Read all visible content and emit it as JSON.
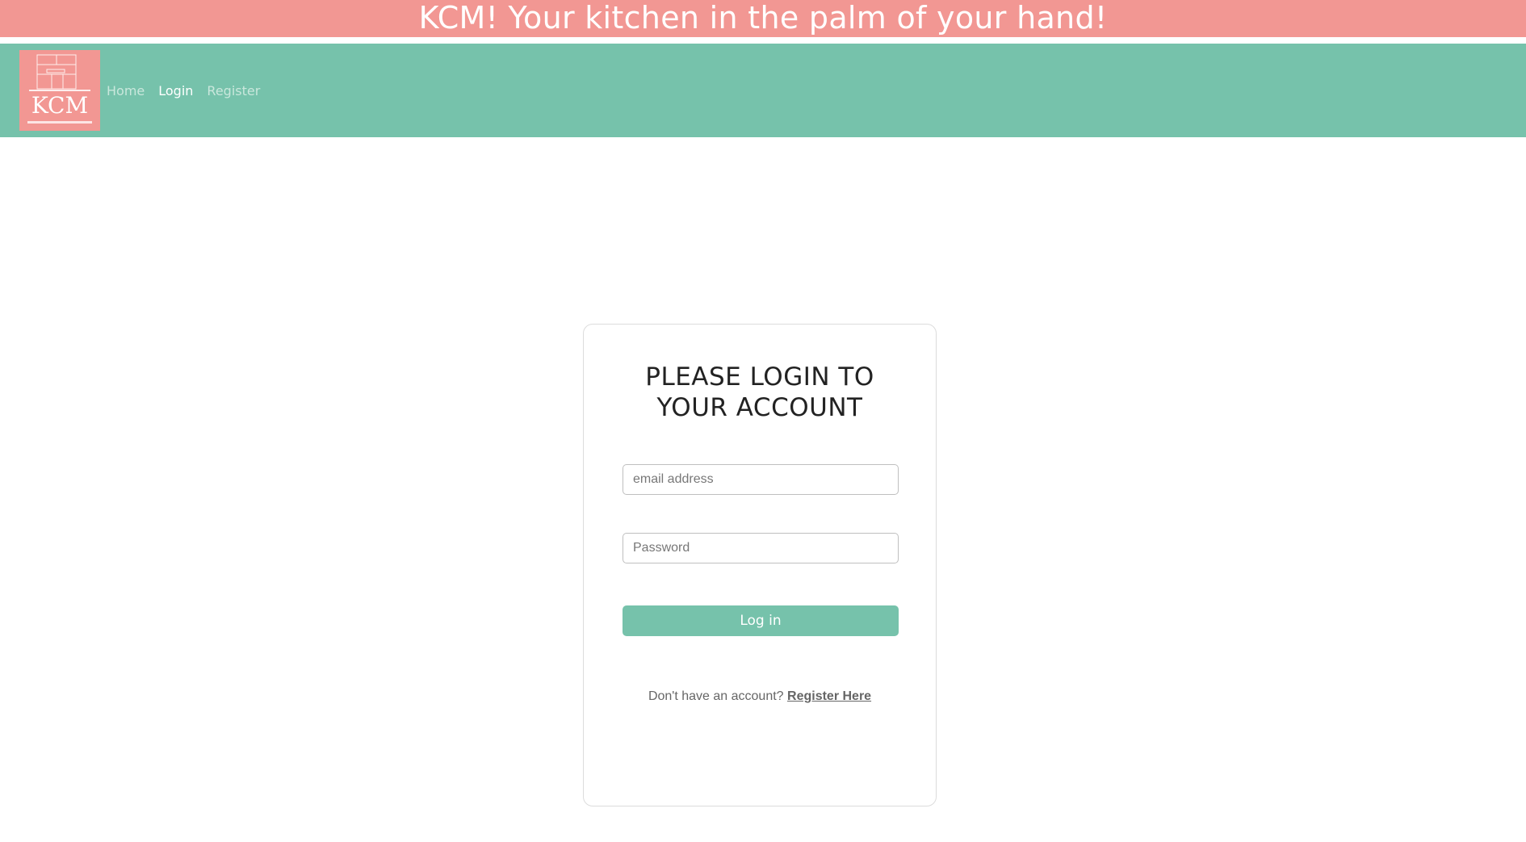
{
  "banner": {
    "text": "KCM! Your kitchen in the palm of your hand!"
  },
  "nav": {
    "logo_text": "KCM",
    "links": [
      {
        "label": "Home",
        "active": false
      },
      {
        "label": "Login",
        "active": true
      },
      {
        "label": "Register",
        "active": false
      }
    ]
  },
  "login": {
    "title_line1": "PLEASE LOGIN TO",
    "title_line2": "YOUR ACCOUNT",
    "email_placeholder": "email address",
    "email_value": "",
    "password_placeholder": "Password",
    "password_value": "",
    "submit_label": "Log in",
    "register_prompt": "Don't have an account?",
    "register_link": "Register Here"
  },
  "colors": {
    "banner": "#f29793",
    "nav": "#76c2ab",
    "button": "#76c2ab",
    "logo_bg": "#f29793"
  }
}
